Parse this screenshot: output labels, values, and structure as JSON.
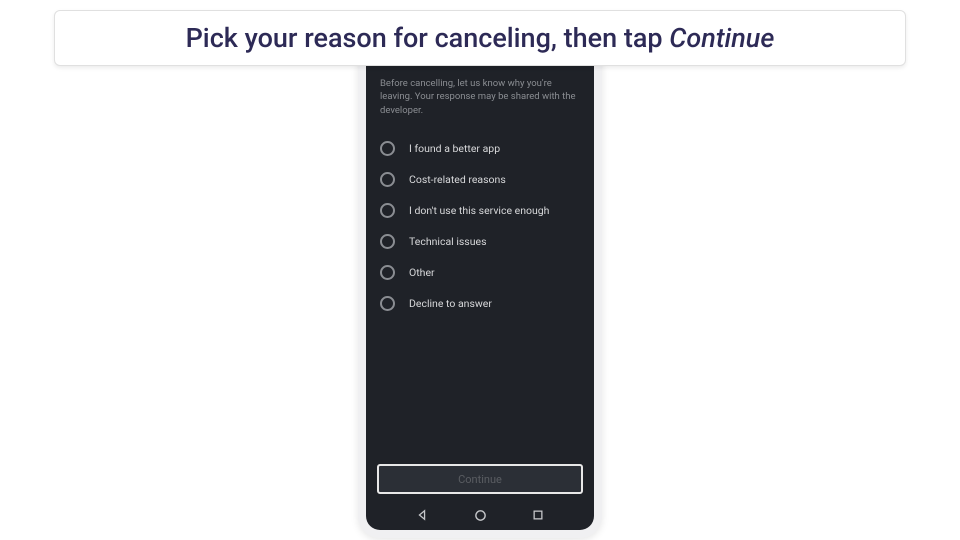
{
  "instruction": {
    "prefix": "Pick your reason for canceling, then tap ",
    "emphasis": "Continue"
  },
  "screen": {
    "intro": "Before cancelling, let us know why you're leaving. Your response may be shared with the developer.",
    "reasons": [
      {
        "label": "I found a better app"
      },
      {
        "label": "Cost-related reasons"
      },
      {
        "label": "I don't use this service enough"
      },
      {
        "label": "Technical issues"
      },
      {
        "label": "Other"
      },
      {
        "label": "Decline to answer"
      }
    ],
    "continue_label": "Continue"
  }
}
